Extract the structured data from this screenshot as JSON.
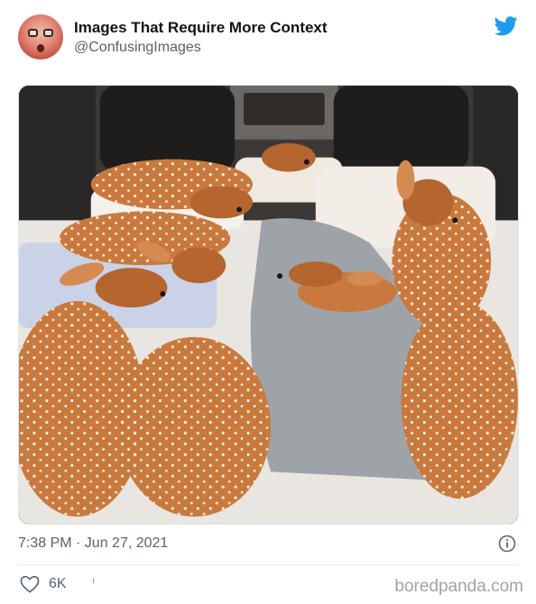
{
  "tweet": {
    "display_name": "Images That Require More Context",
    "handle": "@ConfusingImages",
    "timestamp": "7:38 PM · Jun 27, 2021",
    "like_count": "6K",
    "avatar_icon": "profile-photo",
    "brand_icon": "twitter-bird-icon",
    "brand_color": "#1d9bf0"
  },
  "footer": {
    "watermark": "boredpanda.com"
  }
}
